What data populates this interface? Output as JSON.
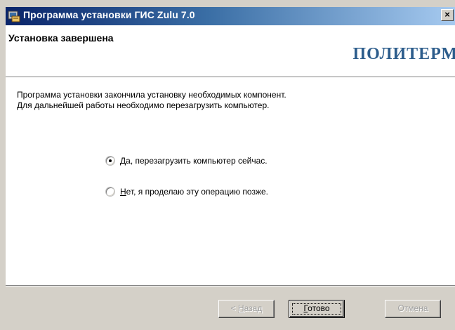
{
  "window": {
    "title": "Программа установки ГИС Zulu 7.0",
    "close_glyph": "×"
  },
  "header": {
    "title": "Установка завершена",
    "logo_text": "ПОЛИТЕРМ"
  },
  "body": {
    "message_line1": "Программа установки закончила установку необходимых  компонент.",
    "message_line2": "Для дальнейшей работы необходимо перезагрузить компьютер.",
    "options": [
      {
        "mnemonic": "Д",
        "rest": "а, перезагрузить компьютер сейчас.",
        "selected": true
      },
      {
        "mnemonic": "Н",
        "rest": "ет, я проделаю эту операцию позже.",
        "selected": false
      }
    ]
  },
  "buttons": {
    "back_prefix": "< ",
    "back_mnemonic": "Н",
    "back_rest": "азад",
    "finish_mnemonic": "Г",
    "finish_rest": "отово",
    "cancel_label": "Отмена"
  },
  "colors": {
    "titlebar_start": "#0a246a",
    "titlebar_end": "#a6caf0",
    "logo": "#2d5d8c",
    "dialog_bg": "#d4d0c8"
  }
}
